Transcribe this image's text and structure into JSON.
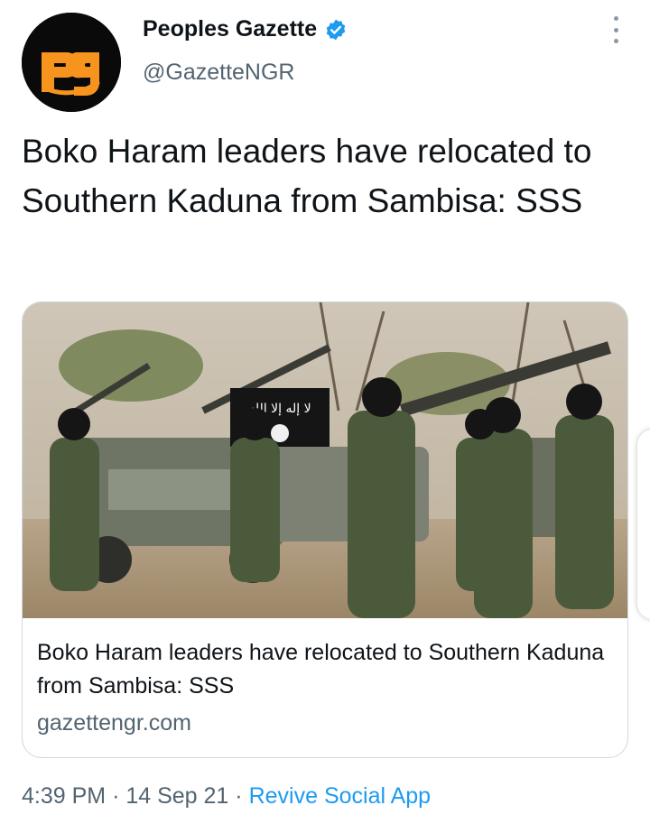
{
  "author": {
    "display_name": "Peoples Gazette",
    "handle": "@GazetteNGR",
    "avatar_text": "pg",
    "verified": true
  },
  "tweet": {
    "text": "Boko Haram leaders have relocated to Southern Kaduna from Sambisa: SSS"
  },
  "card": {
    "title": "Boko Haram leaders have relocated to Southern Kaduna from Sambisa: SSS",
    "domain": "gazettengr.com",
    "image_banner_text": "ﻻ إله إلا الله"
  },
  "meta": {
    "time": "4:39 PM",
    "separator": "·",
    "date": "14 Sep 21",
    "source": "Revive Social App"
  },
  "colors": {
    "accent": "#1d9bf0",
    "logo_orange": "#f7941d",
    "secondary_text": "#536471"
  },
  "icons": {
    "verified": "verified-badge-icon",
    "more": "more-vertical-icon"
  }
}
